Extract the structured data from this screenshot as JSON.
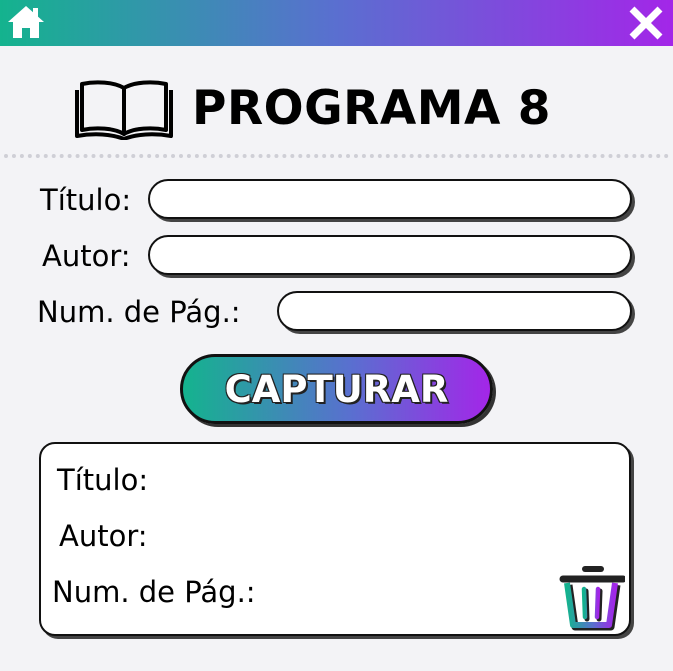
{
  "window": {
    "home_icon": "home-icon",
    "close_icon": "close-icon",
    "bar_gradient": [
      "#14b38e",
      "#5a6fd0",
      "#a326e8"
    ]
  },
  "header": {
    "title": "PROGRAMA 8",
    "icon": "book-icon"
  },
  "form": {
    "title_label": "Título:",
    "title_value": "",
    "author_label": "Autor:",
    "author_value": "",
    "pages_label": "Num. de Pág.:",
    "pages_value": "",
    "capture_label": "CAPTURAR"
  },
  "result": {
    "title_label": "Título:",
    "author_label": "Autor:",
    "pages_label": "Num. de Pág.:",
    "delete_icon": "trash-icon"
  }
}
